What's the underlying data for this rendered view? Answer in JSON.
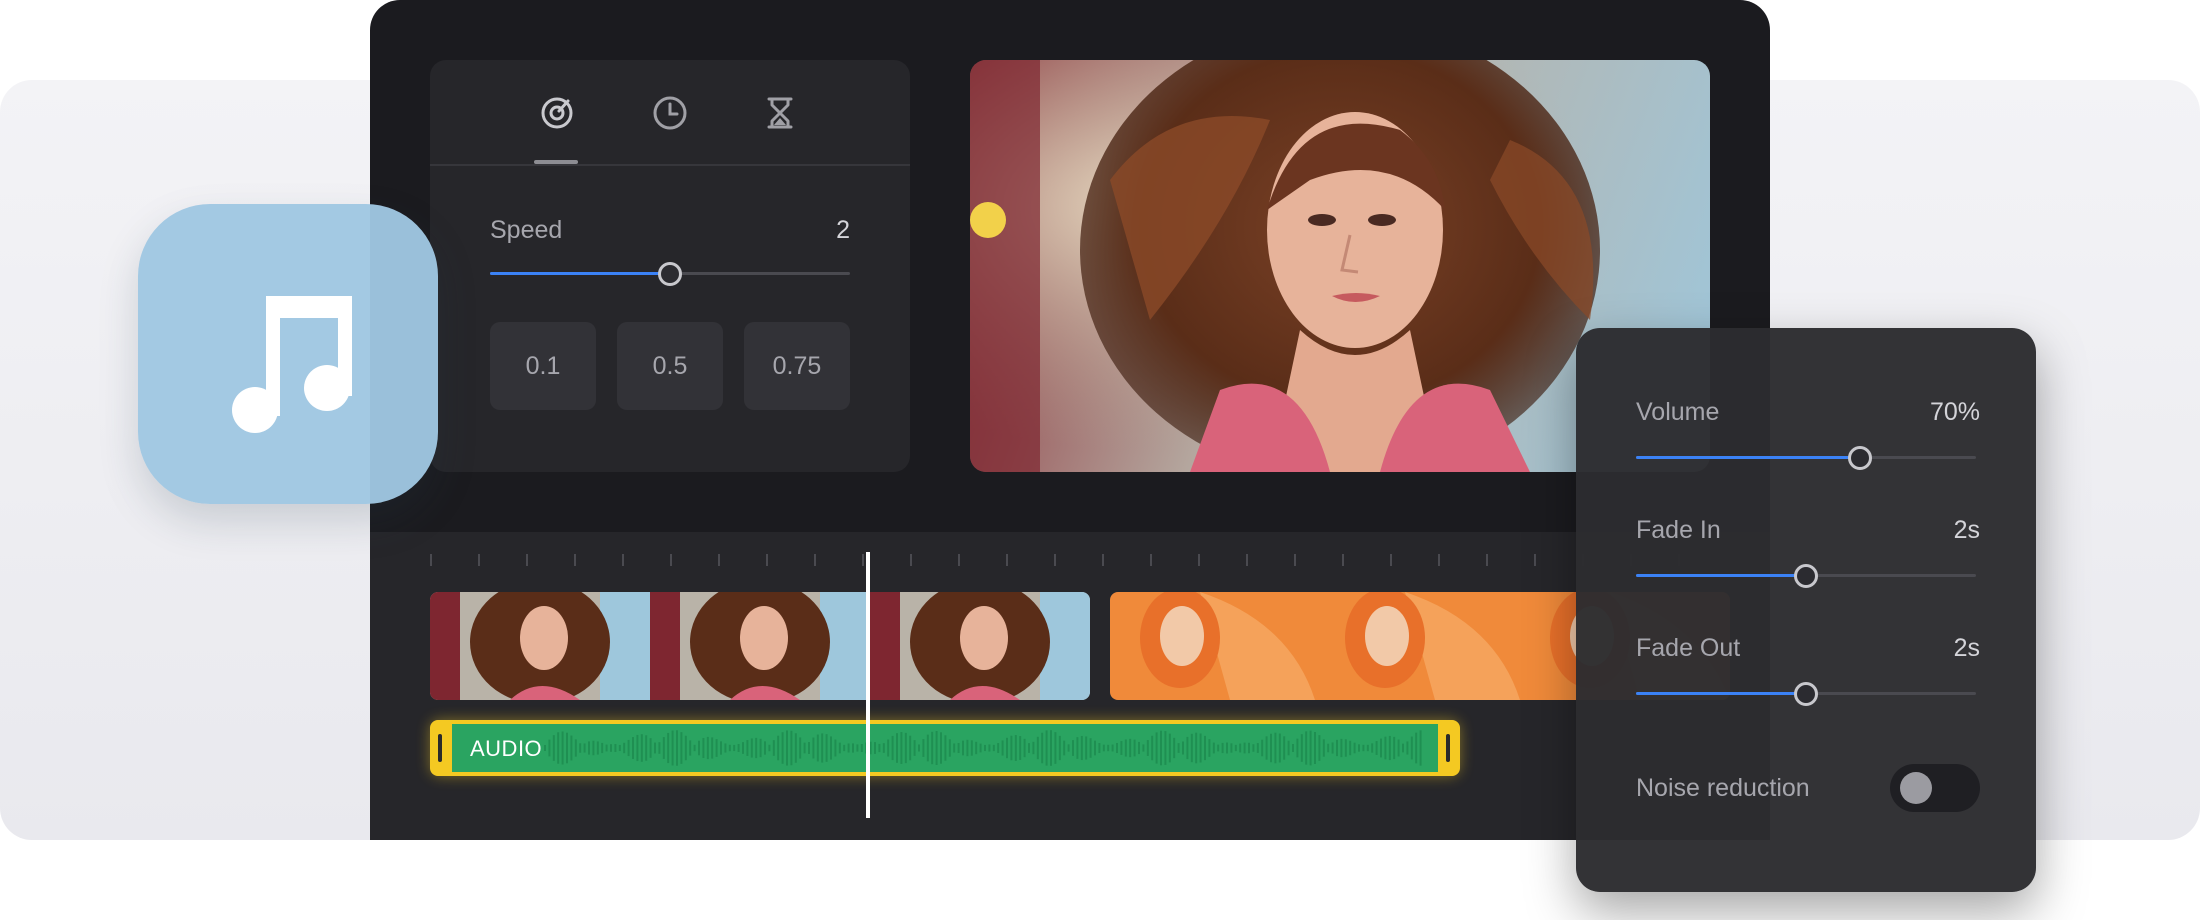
{
  "speed_panel": {
    "tabs": [
      {
        "icon": "speedometer-icon",
        "active": true
      },
      {
        "icon": "clock-icon",
        "active": false
      },
      {
        "icon": "hourglass-icon",
        "active": false
      }
    ],
    "speed_label": "Speed",
    "speed_value": "2",
    "speed_slider_level": 0.5,
    "presets": [
      "0.1",
      "0.5",
      "0.75"
    ]
  },
  "preview": {
    "content": "portrait video frame"
  },
  "timeline": {
    "audio_label": "AUDIO",
    "audio_color": "#2aa461",
    "highlight_color": "#f4c922"
  },
  "music_tile": {
    "icon": "music-note-icon"
  },
  "audio_panel": {
    "volume_label": "Volume",
    "volume_value": "70%",
    "volume_level": 0.66,
    "fade_in_label": "Fade In",
    "fade_in_value": "2s",
    "fade_in_level": 0.5,
    "fade_out_label": "Fade Out",
    "fade_out_value": "2s",
    "fade_out_level": 0.5,
    "noise_reduction_label": "Noise reduction",
    "noise_reduction_on": false
  },
  "colors": {
    "accent": "#3b82f6",
    "panel_bg": "#26262a",
    "editor_bg": "#1b1b1f",
    "tile_bg": "#9fc7e2"
  }
}
